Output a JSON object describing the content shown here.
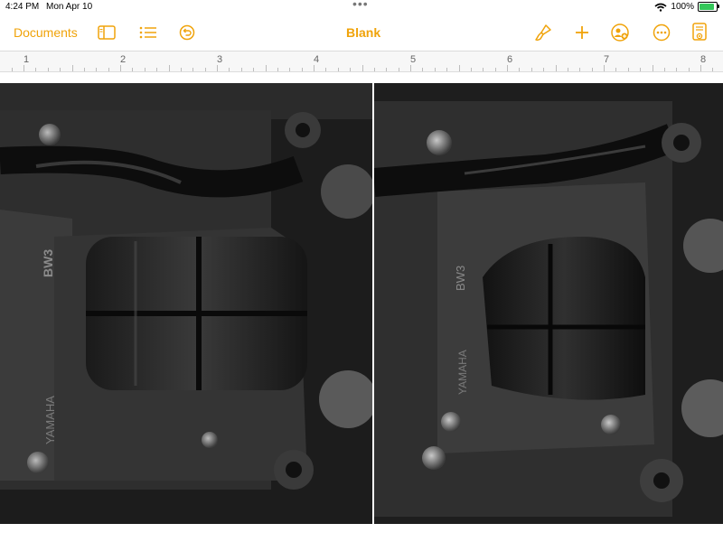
{
  "status_bar": {
    "time": "4:24 PM",
    "date": "Mon Apr 10",
    "battery": "100%"
  },
  "toolbar": {
    "documents_label": "Documents",
    "title": "Blank"
  },
  "ruler": {
    "marks": [
      "1",
      "2",
      "3",
      "4",
      "5",
      "6",
      "7",
      "8"
    ]
  },
  "photos": {
    "left_part_code": "BW3",
    "left_brand": "YAMAHA",
    "right_part_code": "BW3",
    "right_brand": "YAMAHA"
  },
  "colors": {
    "accent": "#f0a30a",
    "battery_green": "#34c759"
  },
  "icons": [
    "sidebar-icon",
    "list-icon",
    "undo-icon",
    "paintbrush-icon",
    "plus-icon",
    "collaborate-icon",
    "more-icon",
    "document-view-icon"
  ]
}
